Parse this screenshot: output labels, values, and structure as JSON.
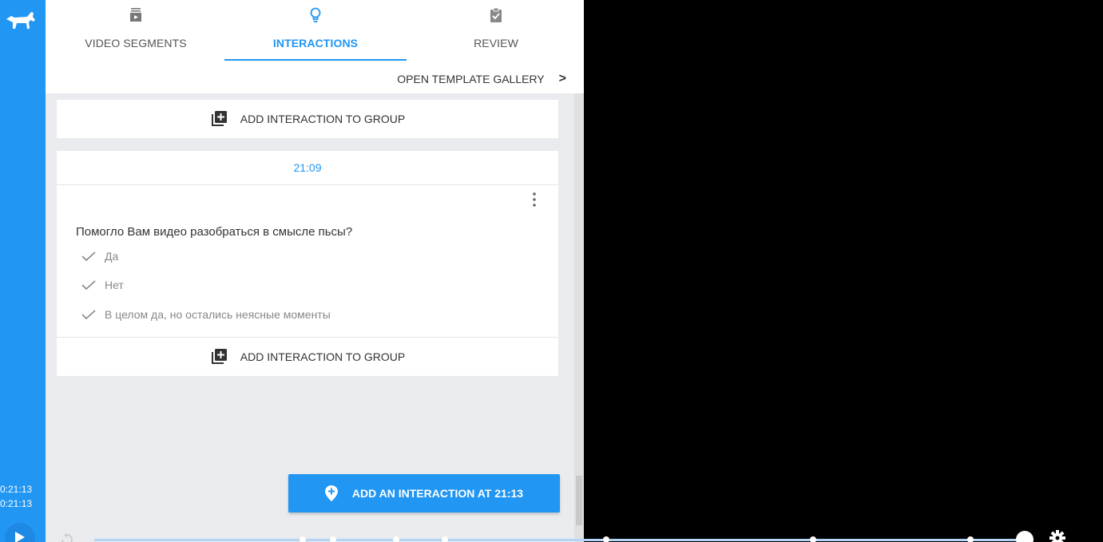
{
  "rail": {
    "current_time": "0:21:13",
    "total_time": "0:21:13"
  },
  "tabs": [
    {
      "label": "VIDEO SEGMENTS",
      "icon": "video-segments-icon"
    },
    {
      "label": "INTERACTIONS",
      "icon": "lightbulb-icon",
      "active": true
    },
    {
      "label": "REVIEW",
      "icon": "clipboard-check-icon"
    }
  ],
  "gallery": {
    "label": "OPEN TEMPLATE GALLERY",
    "chevron": ">"
  },
  "groups": [
    {
      "add_label": "ADD INTERACTION TO GROUP"
    },
    {
      "time": "21:09",
      "question": "Помогло Вам видео разобраться в смысле пьсы?",
      "answers": [
        "Да",
        "Нет",
        "В целом да, но остались неясные моменты"
      ],
      "add_label": "ADD INTERACTION TO GROUP"
    }
  ],
  "add_button": {
    "label": "ADD AN INTERACTION AT 21:13"
  },
  "colors": {
    "accent": "#2196f3",
    "panel_bg": "#e9ebee",
    "video_bg": "#000000"
  }
}
